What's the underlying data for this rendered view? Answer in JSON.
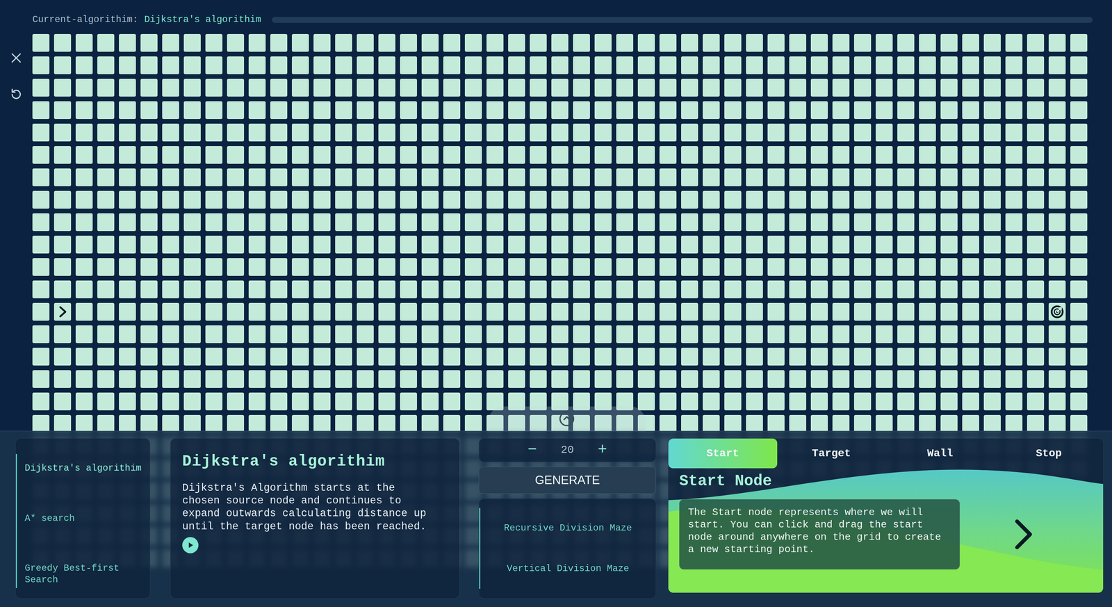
{
  "header": {
    "label": "Current-algorithim:",
    "value": "Dijkstra's algorithim",
    "progress": {
      "level": 0
    }
  },
  "grid": {
    "rows": 24,
    "cols": 49,
    "start": {
      "row": 12,
      "col": 1
    },
    "target": {
      "row": 12,
      "col": 47
    }
  },
  "algorithms": [
    {
      "label": "Dijkstra's algorithim",
      "selected": true
    },
    {
      "label": "A* search",
      "selected": false
    },
    {
      "label": "Greedy Best-first Search",
      "selected": false
    }
  ],
  "description": {
    "title": "Dijkstra's algorithim",
    "text": "Dijkstra's Algorithm starts at the chosen source node and continues to expand outwards calculating distance up until the target node has been reached."
  },
  "counter": {
    "minus": "−",
    "value": "20",
    "plus": "+"
  },
  "generate": "GENERATE",
  "mazes": [
    "Recursive Division Maze",
    "Vertical Division Maze"
  ],
  "tutorial": {
    "tabs": [
      {
        "label": "Start",
        "selected": true
      },
      {
        "label": "Target",
        "selected": false
      },
      {
        "label": "Wall",
        "selected": false
      },
      {
        "label": "Stop",
        "selected": false
      }
    ],
    "title": "Start Node",
    "text": "The Start node represents where we will start. You can click and drag the start node around anywhere on the grid to create a new starting point."
  }
}
